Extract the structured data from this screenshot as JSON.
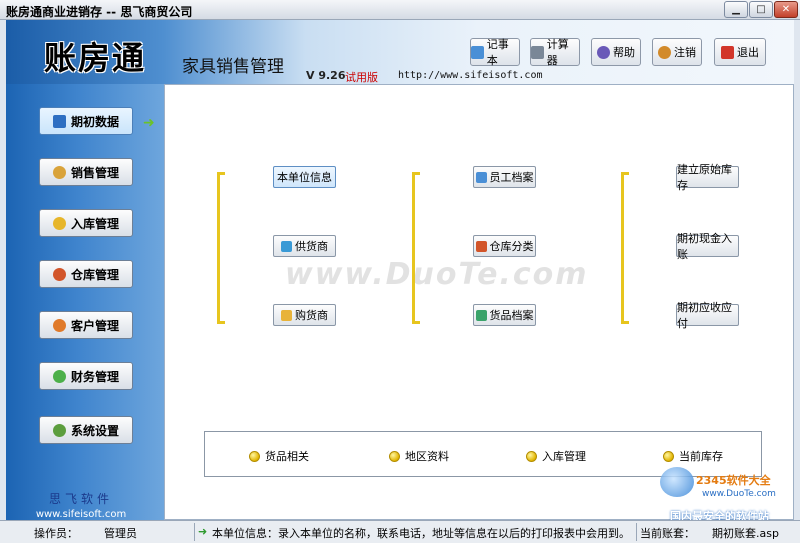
{
  "window": {
    "title": "账房通商业进销存 -- 思飞商贸公司",
    "min_label": "▁",
    "max_label": "□",
    "close_label": "✕"
  },
  "header": {
    "logo": "账房通",
    "subtitle": "家具销售管理",
    "version": "V 9.26",
    "trial": "试用版",
    "url": "http://www.sifeisoft.com"
  },
  "toolbar": {
    "notepad": "记事本",
    "calculator": "计算器",
    "help": "帮助",
    "logout": "注销",
    "exit": "退出"
  },
  "sidebar": {
    "items": [
      {
        "label": "期初数据",
        "icon": "book-icon"
      },
      {
        "label": "销售管理",
        "icon": "sales-icon"
      },
      {
        "label": "入库管理",
        "icon": "box-icon"
      },
      {
        "label": "仓库管理",
        "icon": "warehouse-icon"
      },
      {
        "label": "客户管理",
        "icon": "customers-icon"
      },
      {
        "label": "财务管理",
        "icon": "finance-icon"
      },
      {
        "label": "系统设置",
        "icon": "settings-icon"
      }
    ],
    "brand_cn": "思飞软件",
    "brand_en": "www.sifeisoft.com"
  },
  "content": {
    "col1": [
      "本单位信息",
      "供货商",
      "购货商"
    ],
    "col2": [
      "员工档案",
      "仓库分类",
      "货品档案"
    ],
    "col3": [
      "建立原始库存",
      "期初现金入账",
      "期初应收应付"
    ],
    "watermark": "www.DuoTe.com",
    "links": [
      "货品相关",
      "地区资料",
      "入库管理",
      "当前库存"
    ]
  },
  "corner_logo": {
    "line1": "2345软件大全",
    "line2": "www.DuoTe.com",
    "line3": "国内最安全的软件站"
  },
  "status": {
    "operator_label": "操作员：",
    "operator_value": "管理员",
    "message": "本单位信息：录入本单位的名称，联系电话，地址等信息在以后的打印报表中会用到。",
    "account_label": "当前账套：",
    "account_value": "期初账套.asp"
  },
  "colors": {
    "accent_blue": "#1c64b3",
    "bracket_yellow": "#e7c51e",
    "trial_red": "#cc0000"
  }
}
